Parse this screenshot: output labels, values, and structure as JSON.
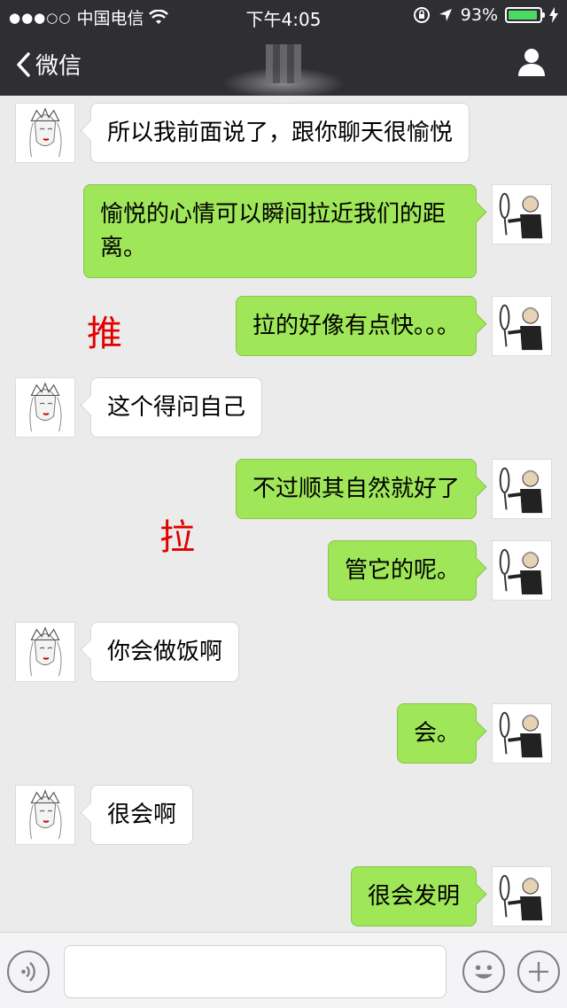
{
  "status_bar": {
    "signal": "●●●○○",
    "carrier": "中国电信",
    "time": "下午4:05",
    "battery_percent": "93%",
    "battery_level": 0.93
  },
  "nav": {
    "back_label": "微信"
  },
  "colors": {
    "outgoing_bubble": "#9fe658",
    "incoming_bubble": "#ffffff",
    "annotation": "#e00000",
    "nav_background": "#2e2e33"
  },
  "messages": [
    {
      "side": "in",
      "text": "所以我前面说了，跟你聊天很愉悦"
    },
    {
      "side": "out",
      "text": "愉悦的心情可以瞬间拉近我们的距离。"
    },
    {
      "side": "out",
      "text": "拉的好像有点快。。。"
    },
    {
      "side": "in",
      "text": "这个得问自己"
    },
    {
      "side": "out",
      "text": "不过顺其自然就好了"
    },
    {
      "side": "out",
      "text": "管它的呢。"
    },
    {
      "side": "in",
      "text": "你会做饭啊"
    },
    {
      "side": "out",
      "text": "会。"
    },
    {
      "side": "in",
      "text": "很会啊"
    },
    {
      "side": "out",
      "text": "很会发明"
    }
  ],
  "annotations": [
    "推",
    "拉"
  ],
  "input_bar": {
    "left_icon": "voice-icon",
    "right_icons": [
      "emoji-icon",
      "plus-icon"
    ]
  }
}
